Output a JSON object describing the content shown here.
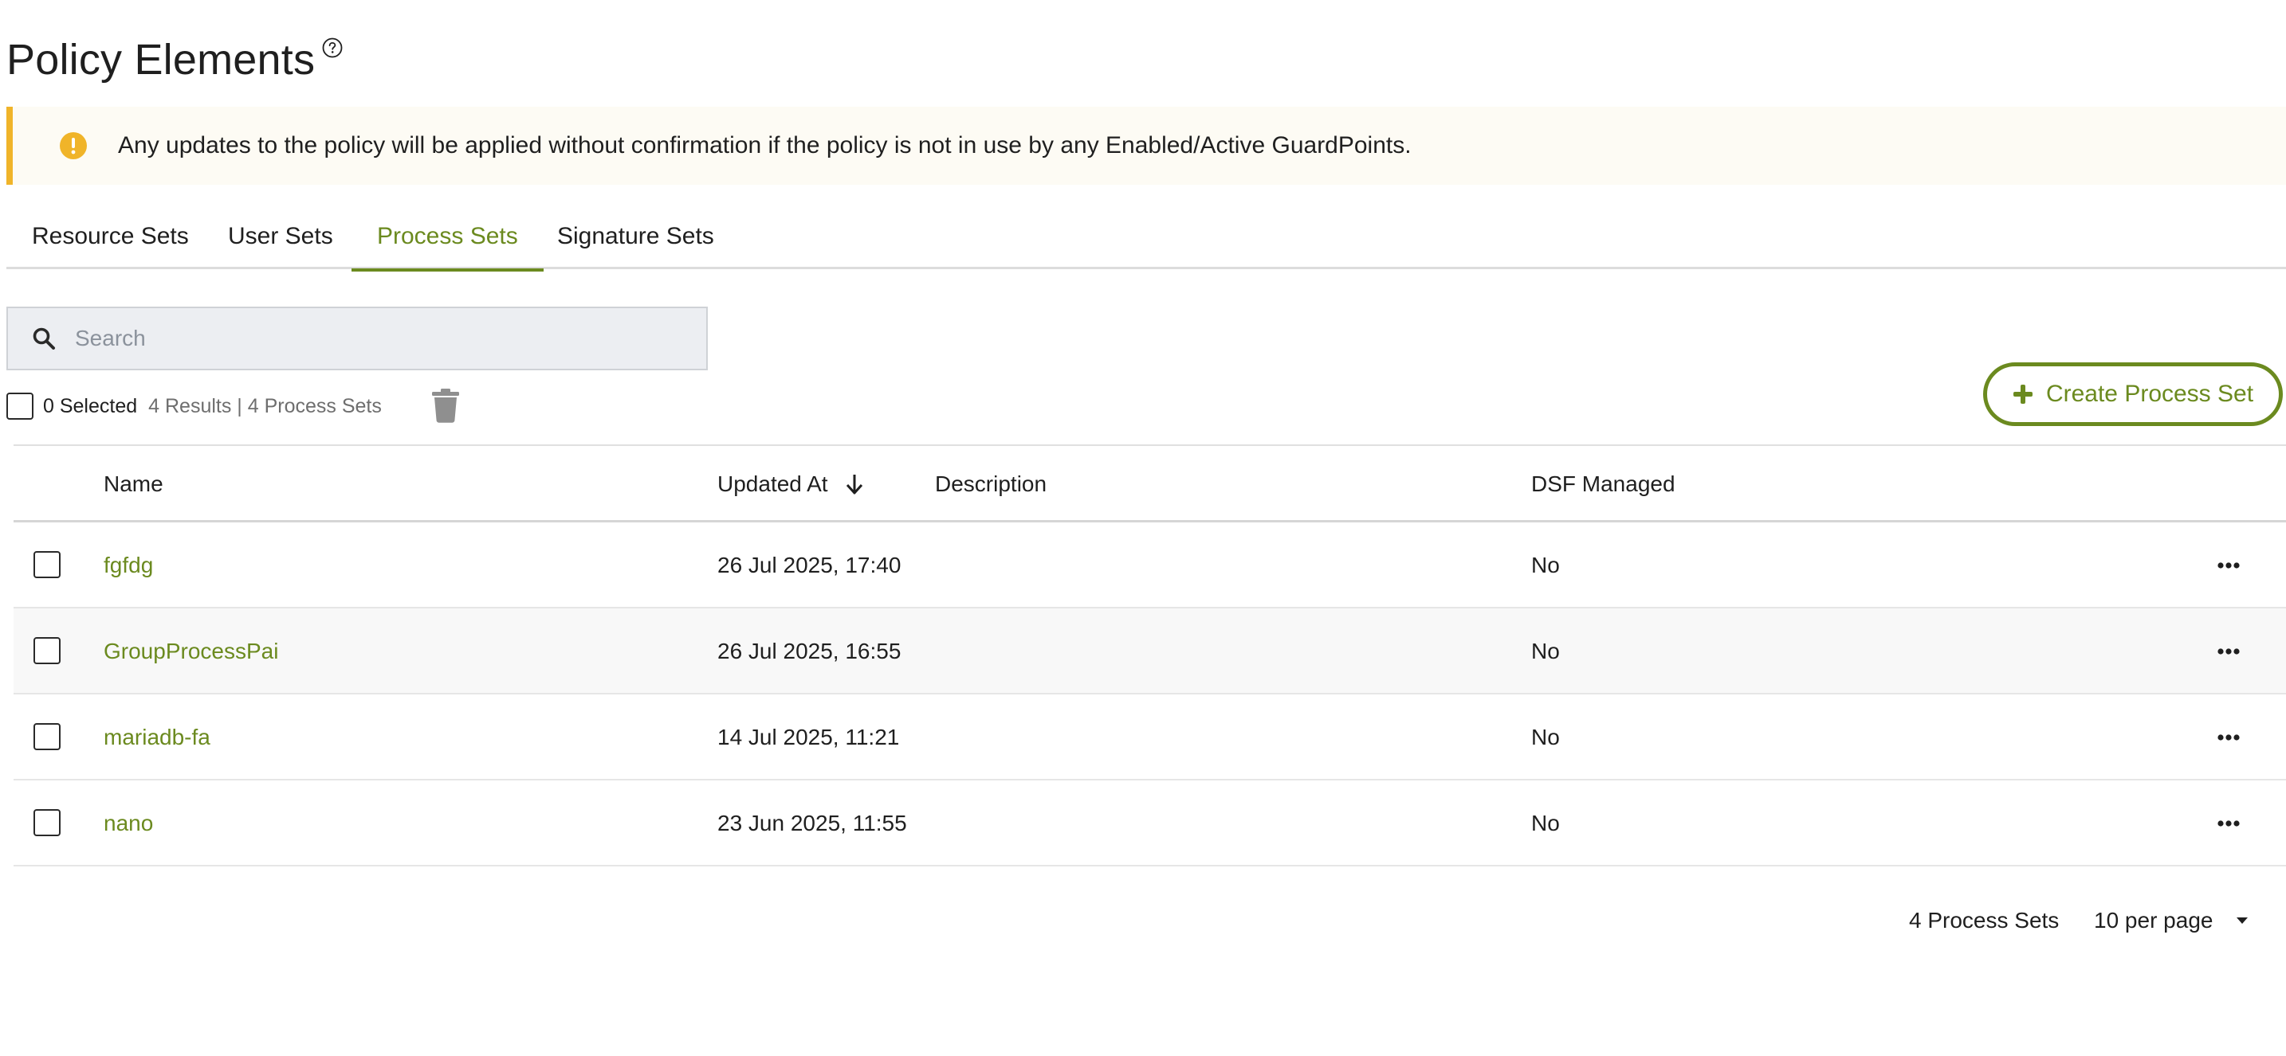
{
  "header": {
    "title": "Policy Elements",
    "help_icon": "question-circle-icon"
  },
  "banner": {
    "icon": "exclamation-circle-icon",
    "text": "Any updates to the policy will be applied without confirmation if the policy is not in use by any Enabled/Active GuardPoints."
  },
  "tabs": [
    {
      "label": "Resource Sets",
      "active": false
    },
    {
      "label": "User Sets",
      "active": false
    },
    {
      "label": "Process Sets",
      "active": true
    },
    {
      "label": "Signature Sets",
      "active": false
    }
  ],
  "search": {
    "placeholder": "Search",
    "value": ""
  },
  "selection": {
    "selected_label": "0 Selected",
    "results_label": "4 Results | 4 Process Sets"
  },
  "create_button": {
    "label": "Create Process Set"
  },
  "table": {
    "columns": [
      "Name",
      "Updated At",
      "Description",
      "DSF Managed"
    ],
    "sort_column": "Updated At",
    "sort_direction": "descending",
    "rows": [
      {
        "name": "fgfdg",
        "updated_at": "26 Jul 2025, 17:40",
        "description": "",
        "dsf_managed": "No"
      },
      {
        "name": "GroupProcessPai",
        "updated_at": "26 Jul 2025, 16:55",
        "description": "",
        "dsf_managed": "No"
      },
      {
        "name": "mariadb-fa",
        "updated_at": "14 Jul 2025, 11:21",
        "description": "",
        "dsf_managed": "No"
      },
      {
        "name": "nano",
        "updated_at": "23 Jun 2025, 11:55",
        "description": "",
        "dsf_managed": "No"
      }
    ]
  },
  "footer": {
    "count_label": "4 Process Sets",
    "per_page_label": "10 per page"
  },
  "colors": {
    "accent": "#6b8a1f",
    "warning": "#f0b429",
    "banner_bg": "#fdfbf4"
  }
}
